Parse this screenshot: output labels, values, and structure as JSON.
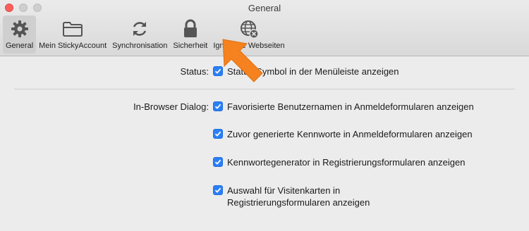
{
  "window": {
    "title": "General"
  },
  "toolbar": {
    "items": [
      {
        "label": "General",
        "icon": "gear-icon",
        "selected": true
      },
      {
        "label": "Mein StickyAccount",
        "icon": "folder-icon",
        "selected": false
      },
      {
        "label": "Synchronisation",
        "icon": "sync-icon",
        "selected": false
      },
      {
        "label": "Sicherheit",
        "icon": "lock-icon",
        "selected": false
      },
      {
        "label": "Ignorierte Webseiten",
        "icon": "globe-blocked-icon",
        "selected": false
      }
    ]
  },
  "status": {
    "label": "Status:",
    "option": {
      "text": "Status-Symbol in der Menüleiste anzeigen",
      "checked": true
    }
  },
  "browser_dialog": {
    "label": "In-Browser Dialog:",
    "options": [
      {
        "text": "Favorisierte Benutzernamen in Anmeldeformularen anzeigen",
        "checked": true
      },
      {
        "text": "Zuvor generierte Kennworte in Anmeldeformularen anzeigen",
        "checked": true
      },
      {
        "text": "Kennwortegenerator in Registrierungsformularen anzeigen",
        "checked": true
      },
      {
        "text": "Auswahl für Visitenkarten in",
        "text2": "Registrierungsformularen anzeigen",
        "checked": true
      }
    ]
  },
  "colors": {
    "accent": "#2a7ff6",
    "arrow": "#f5821f",
    "close": "#fc605c"
  }
}
